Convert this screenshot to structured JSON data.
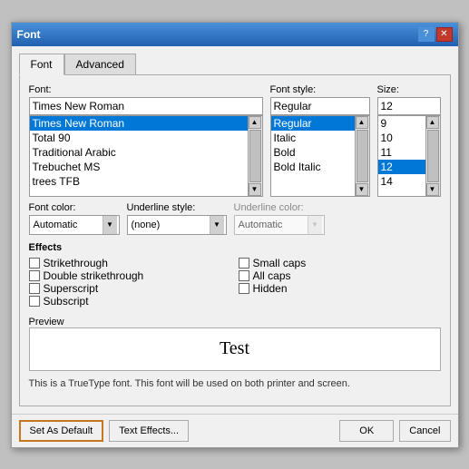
{
  "titleBar": {
    "title": "Font",
    "helpBtn": "?",
    "closeBtn": "✕"
  },
  "tabs": [
    {
      "label": "Font",
      "active": true
    },
    {
      "label": "Advanced",
      "active": false
    }
  ],
  "fontSection": {
    "label": "Font:",
    "inputValue": "Times New Roman",
    "items": [
      {
        "text": "Times New Roman",
        "selected": true
      },
      {
        "text": "Total 90",
        "selected": false
      },
      {
        "text": "Traditional Arabic",
        "selected": false
      },
      {
        "text": "Trebuchet MS",
        "selected": false
      },
      {
        "text": "trees TFB",
        "selected": false
      }
    ]
  },
  "fontStyleSection": {
    "label": "Font style:",
    "inputValue": "Regular",
    "items": [
      {
        "text": "Regular",
        "selected": true
      },
      {
        "text": "Italic",
        "selected": false
      },
      {
        "text": "Bold",
        "selected": false
      },
      {
        "text": "Bold Italic",
        "selected": false
      }
    ]
  },
  "sizeSection": {
    "label": "Size:",
    "inputValue": "12",
    "items": [
      {
        "text": "9",
        "selected": false
      },
      {
        "text": "10",
        "selected": false
      },
      {
        "text": "11",
        "selected": false
      },
      {
        "text": "12",
        "selected": true
      },
      {
        "text": "14",
        "selected": false
      }
    ]
  },
  "fontColor": {
    "label": "Font color:",
    "value": "Automatic"
  },
  "underlineStyle": {
    "label": "Underline style:",
    "value": "(none)"
  },
  "underlineColor": {
    "label": "Underline color:",
    "value": "Automatic",
    "disabled": true
  },
  "effects": {
    "label": "Effects",
    "leftItems": [
      {
        "label": "Strikethrough",
        "checked": false
      },
      {
        "label": "Double strikethrough",
        "checked": false
      },
      {
        "label": "Superscript",
        "checked": false
      },
      {
        "label": "Subscript",
        "checked": false
      }
    ],
    "rightItems": [
      {
        "label": "Small caps",
        "checked": false
      },
      {
        "label": "All caps",
        "checked": false
      },
      {
        "label": "Hidden",
        "checked": false
      }
    ]
  },
  "preview": {
    "label": "Preview",
    "text": "Test"
  },
  "infoText": "This is a TrueType font. This font will be used on both printer and screen.",
  "footer": {
    "setDefaultBtn": "Set As Default",
    "textEffectsBtn": "Text Effects...",
    "okBtn": "OK",
    "cancelBtn": "Cancel"
  }
}
